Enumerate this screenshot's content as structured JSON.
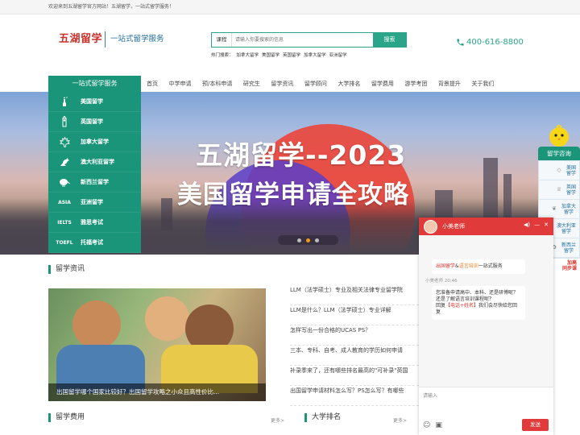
{
  "topbar": {
    "welcome": "欢迎来到五湖留学官方网站！五湖留学，一站式留学服务！"
  },
  "header": {
    "logo": "五湖留学",
    "slogan": "一站式留学服务",
    "search": {
      "category": "课程",
      "placeholder": "请输入你要搜索的信息",
      "button": "搜索"
    },
    "hot_label": "热门搜索：",
    "hot_items": [
      "加拿大留学",
      "美国留学",
      "英国留学",
      "加拿大留学",
      "亚洲留学"
    ],
    "phone": "400-616-8800"
  },
  "nav": {
    "service": "一站式留学服务",
    "items": [
      "首页",
      "中学申请",
      "预/本科申请",
      "研究生",
      "留学资讯",
      "留学顾问",
      "大学排名",
      "留学费用",
      "游学考团",
      "背景提升",
      "关于我们"
    ]
  },
  "side_menu": [
    {
      "icon": "statue-of-liberty-icon",
      "label": "美国留学"
    },
    {
      "icon": "big-ben-icon",
      "label": "英国留学"
    },
    {
      "icon": "maple-leaf-icon",
      "label": "加拿大留学"
    },
    {
      "icon": "kangaroo-icon",
      "label": "澳大利亚留学"
    },
    {
      "icon": "kiwi-bird-icon",
      "label": "新西兰留学"
    },
    {
      "icon": "asia-text-icon",
      "icon_text": "ASIA",
      "label": "亚洲留学"
    },
    {
      "icon": "ielts-text-icon",
      "icon_text": "IELTS",
      "label": "雅思考试"
    },
    {
      "icon": "toefl-text-icon",
      "icon_text": "TOEFL",
      "label": "托福考试"
    }
  ],
  "banner": {
    "line1": "五湖留学--2023",
    "line2": "美国留学申请全攻略"
  },
  "news": {
    "title": "留学资讯",
    "image_caption": "出国留学哪个国家比较好？出国留学攻略之小众且高性价比...",
    "items": [
      "LLM（法学硕士）专业及相关法律专业留学院",
      "LLM是什么？LLM（法学硕士）专业详解",
      "怎样写出一份合格的UCAS PS？",
      "三本、专科、自考、成人教育的学历如何申请",
      "补录季来了，还有哪些排名最高的\"可补录\"英国",
      "出国留学申请材料怎么写？PS怎么写？有哪些"
    ]
  },
  "fees": {
    "title": "留学费用",
    "more": "更多>"
  },
  "rank": {
    "title": "大学排名",
    "more": "更多>"
  },
  "float": {
    "title": "留学咨询",
    "items": [
      {
        "icon": "diamond-icon",
        "label": "美国\n留学"
      },
      {
        "icon": "crown-icon",
        "label": "英国\n留学"
      },
      {
        "icon": "leaf-icon",
        "label": "加拿大\n留学"
      },
      {
        "icon": "sun-icon",
        "label": "澳大利亚\n留学"
      },
      {
        "icon": "bird-icon",
        "label": "新西兰\n留学"
      }
    ],
    "promo": "加高\n同步课"
  },
  "chat": {
    "agent": "小美老师",
    "timestamp": "小美老师 20:46",
    "msg1_a": "出国留学",
    "msg1_b": "&",
    "msg1_c": "语言培训",
    "msg1_d": "一站式服务",
    "msg2": "您准备申请高中、本科、还是研博呢？",
    "msg3": "还是了解语言培训课程呢？",
    "msg4_a": "回复",
    "msg4_b": "【电话+姓名】",
    "msg4_c": "我们会尽快给您回复",
    "input_placeholder": "请输入",
    "send": "发送"
  },
  "colors": {
    "brand_green": "#1a9579",
    "accent_red": "#e03a3a",
    "logo_red": "#c9302c"
  }
}
